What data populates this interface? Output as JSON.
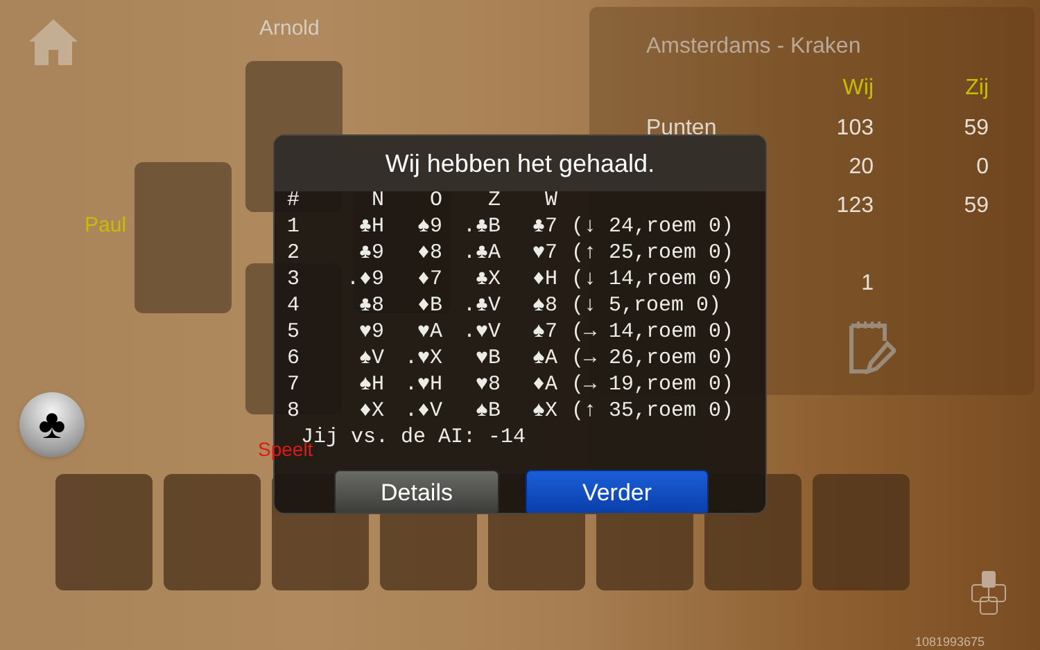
{
  "players": [
    {
      "name": "Arnold",
      "kind": "top"
    },
    {
      "name": "Paul",
      "kind": "left"
    }
  ],
  "turn_label": "Speelt",
  "score_panel": {
    "title": "Amsterdams - Kraken",
    "columns": [
      "Wij",
      "Zij"
    ],
    "rows": [
      {
        "label": "Punten",
        "values": [
          "103",
          "59"
        ]
      },
      {
        "label": "",
        "values": [
          "20",
          "0"
        ]
      },
      {
        "label": "",
        "values": [
          "123",
          "59"
        ]
      },
      {
        "label": "",
        "values": [
          "1"
        ]
      }
    ]
  },
  "dialog": {
    "title": "Wij hebben het gehaald.",
    "header": [
      "#",
      "N",
      "O",
      "Z",
      "W"
    ],
    "tricks": [
      {
        "cells": [
          "1",
          "♣H",
          "♠9",
          ".♣B",
          "♣7"
        ],
        "result": "(↓ 24,roem 0)"
      },
      {
        "cells": [
          "2",
          "♣9",
          "♦8",
          ".♣A",
          "♥7"
        ],
        "result": "(↑ 25,roem 0)"
      },
      {
        "cells": [
          "3",
          ".♦9",
          "♦7",
          "♣X",
          "♦H"
        ],
        "result": "(↓ 14,roem 0)"
      },
      {
        "cells": [
          "4",
          "♣8",
          "♦B",
          ".♣V",
          "♠8"
        ],
        "result": "(↓ 5,roem 0)"
      },
      {
        "cells": [
          "5",
          "♥9",
          "♥A",
          ".♥V",
          "♠7"
        ],
        "result": "(→ 14,roem 0)"
      },
      {
        "cells": [
          "6",
          "♠V",
          ".♥X",
          "♥B",
          "♠A"
        ],
        "result": "(→ 26,roem 0)"
      },
      {
        "cells": [
          "7",
          "♠H",
          ".♥H",
          "♥8",
          "♦A"
        ],
        "result": "(→ 19,roem 0)"
      },
      {
        "cells": [
          "8",
          "♦X",
          ".♦V",
          "♠B",
          "♠X"
        ],
        "result": "(↑ 35,roem 0)"
      }
    ],
    "summary": "Jij vs. de AI: -14",
    "buttons": [
      {
        "label": "Details",
        "kind": "secondary"
      },
      {
        "label": "Verder",
        "kind": "primary"
      }
    ]
  },
  "trump_button": {
    "symbol": "♣"
  },
  "game_id": "1081993675"
}
